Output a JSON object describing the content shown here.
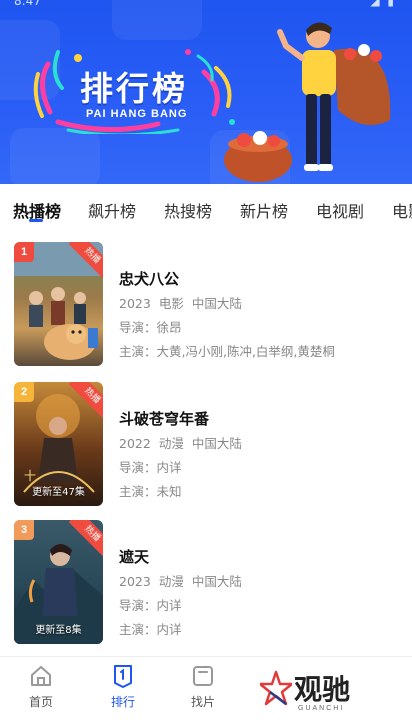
{
  "status_bar": {
    "time": "8:47",
    "icons": "◢ ▮"
  },
  "banner": {
    "title": "排行榜",
    "subtitle": "PAI HANG BANG"
  },
  "tabs": [
    {
      "label": "热播榜",
      "active": true
    },
    {
      "label": "飙升榜",
      "active": false
    },
    {
      "label": "热搜榜",
      "active": false
    },
    {
      "label": "新片榜",
      "active": false
    },
    {
      "label": "电视剧",
      "active": false
    },
    {
      "label": "电影",
      "active": false
    }
  ],
  "items": [
    {
      "rank": "1",
      "rank_color": "#ef4b3f",
      "badge": "热播",
      "title": "忠犬八公",
      "year": "2023",
      "genre": "电影",
      "region": "中国大陆",
      "director": "导演：徐昂",
      "cast": "主演：大黄,冯小刚,陈冲,白举纲,黄楚桐",
      "poster_caption": ""
    },
    {
      "rank": "2",
      "rank_color": "#f5b43a",
      "badge": "热播",
      "title": "斗破苍穹年番",
      "year": "2022",
      "genre": "动漫",
      "region": "中国大陆",
      "director": "导演：内详",
      "cast": "主演：未知",
      "poster_caption": "更新至47集"
    },
    {
      "rank": "3",
      "rank_color": "#f29a5a",
      "badge": "热播",
      "title": "遮天",
      "year": "2023",
      "genre": "动漫",
      "region": "中国大陆",
      "director": "导演：内详",
      "cast": "主演：内详",
      "poster_caption": "更新至8集"
    }
  ],
  "bottom_nav": [
    {
      "label": "首页",
      "icon": "home-icon",
      "active": false
    },
    {
      "label": "排行",
      "icon": "ranking-icon",
      "active": true
    },
    {
      "label": "找片",
      "icon": "find-icon",
      "active": false
    }
  ],
  "watermark": {
    "text": "观驰",
    "sub": "GUANCHI"
  },
  "colors": {
    "brand_blue": "#1f55f0",
    "hot_red": "#ef4b3f",
    "text_gray": "#888888"
  }
}
